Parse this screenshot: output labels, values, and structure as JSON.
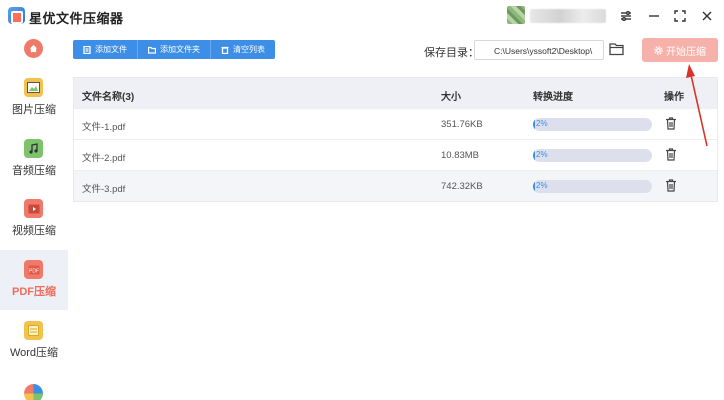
{
  "window": {
    "title": "星优文件压缩器",
    "controls": [
      "menu-icon",
      "minimize-icon",
      "maximize-icon",
      "close-icon"
    ]
  },
  "sidebar": {
    "items": [
      {
        "label": "图片压缩",
        "icon": "image-icon",
        "color": "#f2c14e",
        "active": false
      },
      {
        "label": "音频压缩",
        "icon": "music-icon",
        "color": "#7cc36b",
        "active": false
      },
      {
        "label": "视频压缩",
        "icon": "video-icon",
        "color": "#f07a6a",
        "active": false
      },
      {
        "label": "PDF压缩",
        "icon": "pdf-icon",
        "color": "#f07a6a",
        "active": true
      },
      {
        "label": "Word压缩",
        "icon": "word-icon",
        "color": "#f2c14e",
        "active": false
      }
    ]
  },
  "toolbar": {
    "add_file": "添加文件",
    "add_folder": "添加文件夹",
    "clear_list": "清空列表",
    "save_label": "保存目录：",
    "save_path": "C:\\Users\\yssoft2\\Desktop\\",
    "start_button": "开始压缩"
  },
  "table": {
    "headers": {
      "name": "文件名称(3)",
      "size": "大小",
      "progress": "转换进度",
      "action": "操作"
    },
    "rows": [
      {
        "name": "文件-1.pdf",
        "size": "351.76KB",
        "progress_text": "2%",
        "progress": 0.02
      },
      {
        "name": "文件-2.pdf",
        "size": "10.83MB",
        "progress_text": "2%",
        "progress": 0.02
      },
      {
        "name": "文件-3.pdf",
        "size": "742.32KB",
        "progress_text": "2%",
        "progress": 0.02
      }
    ]
  },
  "colors": {
    "accent": "#3d8ee6",
    "start_button": "#f6b1ab",
    "active_side": "#f06c5a",
    "annotation_arrow": "#d9332b"
  }
}
